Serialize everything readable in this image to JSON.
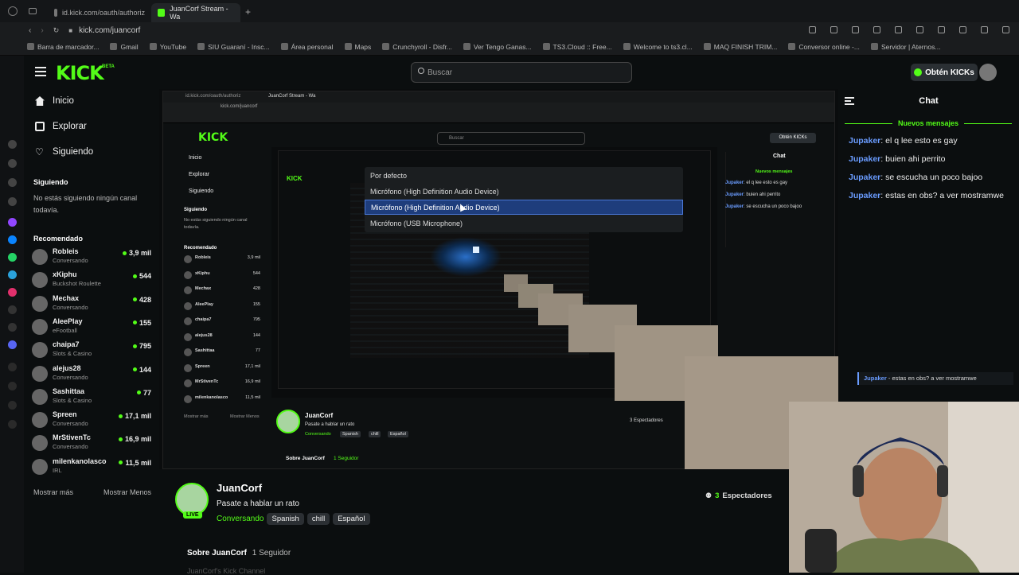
{
  "browser": {
    "tabs": [
      {
        "label": "id.kick.com/oauth/authoriz"
      },
      {
        "label": "JuanCorf Stream - Wa"
      }
    ],
    "url": "kick.com/juancorf",
    "bookmarks": [
      "Barra de marcador...",
      "Gmail",
      "YouTube",
      "SIU Guaraní - Insc...",
      "Área personal",
      "Maps",
      "Crunchyroll - Disfr...",
      "Ver Tengo Ganas...",
      "TS3.Cloud :: Free...",
      "Welcome to ts3.cl...",
      "MAQ FINISH TRIM...",
      "Conversor online -...",
      "Servidor | Aternos..."
    ]
  },
  "header": {
    "logo": "KICK",
    "beta": "BETA",
    "search_placeholder": "Buscar",
    "get_kicks": "Obtén KICKs"
  },
  "sidebar": {
    "nav": [
      {
        "label": "Inicio",
        "icon": "home-icon"
      },
      {
        "label": "Explorar",
        "icon": "browse-icon"
      },
      {
        "label": "Siguiendo",
        "icon": "heart-icon"
      }
    ],
    "following_title": "Siguiendo",
    "following_empty": "No estás siguiendo ningún canal todavía.",
    "recommended_title": "Recomendado",
    "recommended": [
      {
        "name": "Robleis",
        "category": "Conversando",
        "viewers": "3,9 mil"
      },
      {
        "name": "xKiphu",
        "category": "Buckshot Roulette",
        "viewers": "544"
      },
      {
        "name": "Mechax",
        "category": "Conversando",
        "viewers": "428"
      },
      {
        "name": "AleePlay",
        "category": "eFootball",
        "viewers": "155"
      },
      {
        "name": "chaipa7",
        "category": "Slots & Casino",
        "viewers": "795"
      },
      {
        "name": "alejus28",
        "category": "Conversando",
        "viewers": "144"
      },
      {
        "name": "Sashittaa",
        "category": "Slots & Casino",
        "viewers": "77"
      },
      {
        "name": "Spreen",
        "category": "Conversando",
        "viewers": "17,1 mil"
      },
      {
        "name": "MrStivenTc",
        "category": "Conversando",
        "viewers": "16,9 mil"
      },
      {
        "name": "milenkanolasco",
        "category": "IRL",
        "viewers": "11,5 mil"
      }
    ],
    "show_more": "Mostrar más",
    "show_less": "Mostrar Menos"
  },
  "dropdown": {
    "options": [
      "Por defecto",
      "Micrófono (High Definition Audio Device)",
      "Micrófono (High Definition Audio Device)",
      "Micrófono (USB Microphone)"
    ],
    "selected_index": 2
  },
  "stream": {
    "streamer": "JuanCorf",
    "title": "Pasate a hablar un rato",
    "category": "Conversando",
    "tags": [
      "Spanish",
      "chill",
      "Español"
    ],
    "live": "LIVE",
    "viewers_count": "3",
    "viewers_label": "Espectadores",
    "about_title": "Sobre JuanCorf",
    "followers": "1 Seguidor",
    "about_sub": "JuanCorf's Kick Channel"
  },
  "chat": {
    "title": "Chat",
    "new_messages": "Nuevos mensajes",
    "messages": [
      {
        "user": "Jupaker",
        "text": ": el q lee esto es gay"
      },
      {
        "user": "Jupaker",
        "text": ": buien ahi perrito"
      },
      {
        "user": "Jupaker",
        "text": ": se escucha un poco bajoo"
      },
      {
        "user": "Jupaker",
        "text": ": estas en obs? a ver mostramwe"
      }
    ],
    "overlay_user": "Jupaker",
    "overlay_text": "- estas en obs? a ver mostramwe"
  },
  "nested": {
    "tab1": "id.kick.com/oauth/authoriz",
    "tab2": "JuanCorf Stream - Wa",
    "url": "kick.com/juancorf",
    "search": "Buscar",
    "get_kicks": "Obtén KICKs",
    "chat": "Chat",
    "new_messages": "Nuevos mensajes",
    "msg1_user": "Jupaker",
    "msg1": ": el q lee esto es gay",
    "msg2_user": "Jupaker",
    "msg2": ": buien ahi perrito",
    "msg3_user": "Jupaker",
    "msg3": ": se escucha un poco bajoo",
    "nav1": "Inicio",
    "nav2": "Explorar",
    "nav3": "Siguiendo",
    "following": "Siguiendo",
    "empty": "No estás siguiendo ningún canal todavía.",
    "recommended": "Recomendado",
    "streamer": "JuanCorf",
    "title": "Pasate a hablar un rato",
    "category": "Conversando",
    "tag1": "Spanish",
    "tag2": "chill",
    "tag3": "Español",
    "viewers": "3 Espectadores",
    "about": "Sobre JuanCorf",
    "followers": "1 Seguidor",
    "show_more": "Mostrar más",
    "show_less": "Mostrar Menos"
  },
  "colors": {
    "brand": "#53fc18",
    "chat_user": "#6a9cff",
    "dropdown_selected": "#1e3d7c"
  }
}
